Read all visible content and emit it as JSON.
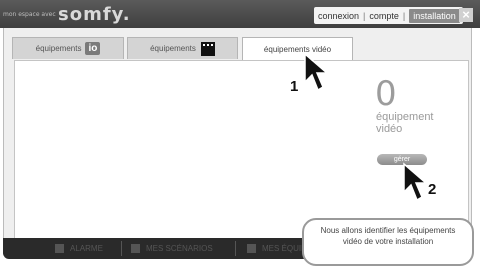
{
  "header": {
    "brand_prefix": "mon espace avec",
    "brand": "somfy.",
    "nav": {
      "connexion": "connexion",
      "compte": "compte",
      "installation": "installation"
    },
    "close": "×"
  },
  "tabs": [
    {
      "label": "équipements",
      "badge": "io"
    },
    {
      "label": "équipements",
      "badge": "RTS"
    },
    {
      "label": "équipements vidéo"
    }
  ],
  "main": {
    "count": "0",
    "count_label_line1": "équipement",
    "count_label_line2": "vidéo",
    "manage_button": "gérer"
  },
  "annotations": {
    "step1": "1",
    "step2": "2"
  },
  "bottom_bar": [
    {
      "label": "ALARME"
    },
    {
      "label": "MES SCÉNARIOS"
    },
    {
      "label": "MES ÉQUIPEMENTS"
    }
  ],
  "tooltip": {
    "line1": "Nous allons identifier les équipements",
    "line2": "vidéo de votre installation"
  },
  "colors": {
    "topbar": "#4a4a4a",
    "active_nav": "#8a8a8a",
    "panel": "#efefef"
  }
}
